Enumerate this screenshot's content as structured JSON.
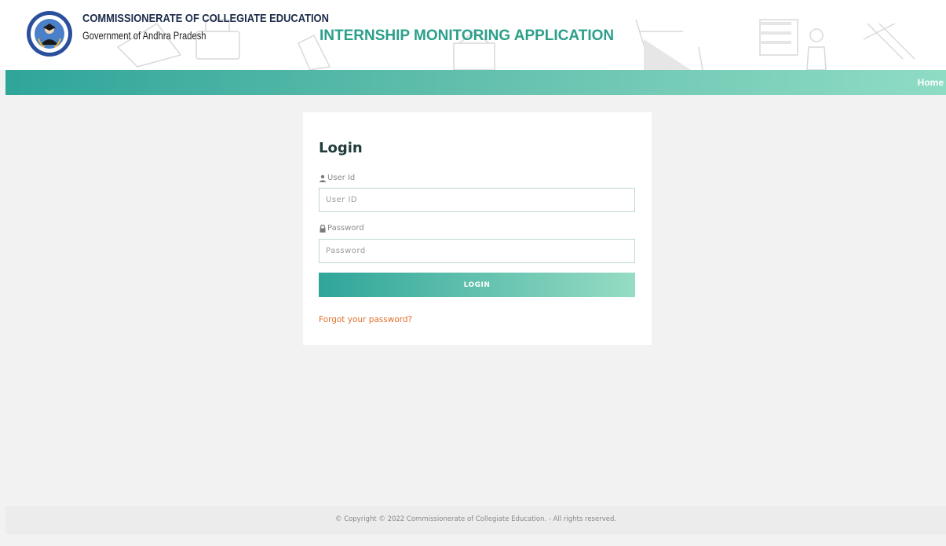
{
  "header": {
    "org_title": "COMMISSIONERATE OF COLLEGIATE EDUCATION",
    "org_subtitle": "Government of Andhra Pradesh",
    "app_title": "INTERNSHIP MONITORING APPLICATION",
    "logo_icon": "emblem-seal-icon"
  },
  "nav": {
    "home_label": "Home"
  },
  "login": {
    "title": "Login",
    "user_label": "User Id",
    "user_placeholder": "User ID",
    "password_label": "Password",
    "password_placeholder": "Password",
    "button_label": "LOGIN",
    "forgot_label": "Forgot your password?"
  },
  "footer": {
    "copyright": "© Copyright © 2022 Commissionerate of Collegiate Education. - All rights reserved."
  },
  "colors": {
    "accent": "#2fa59a",
    "accent_light": "#8fdcc5",
    "title_teal": "#2b9f8a",
    "link_orange": "#e0702e",
    "page_bg": "#f2f2f2"
  }
}
